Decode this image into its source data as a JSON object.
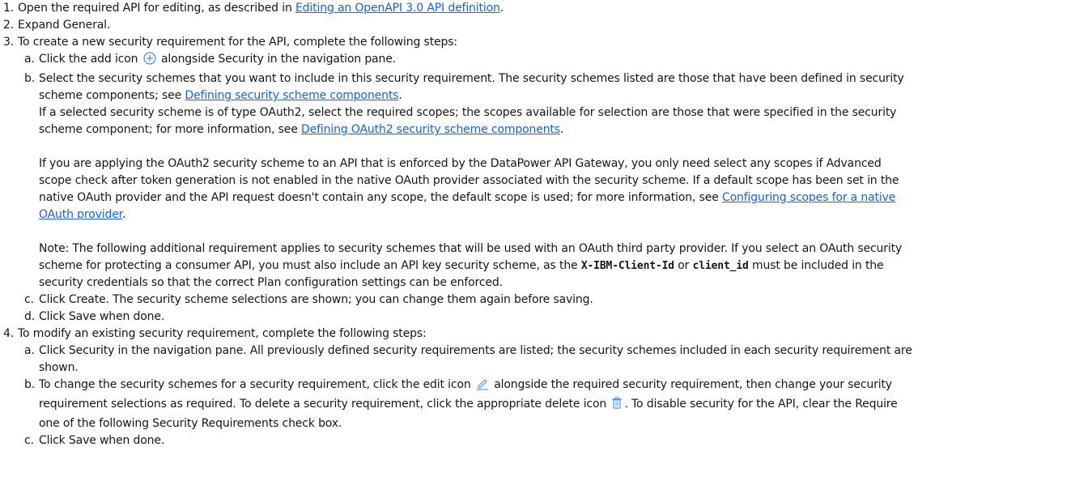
{
  "steps": {
    "s1": {
      "num": "1.",
      "pre": "Open the required API for editing, as described in ",
      "link": "Editing an OpenAPI 3.0 API definition",
      "post": "."
    },
    "s2": {
      "num": "2.",
      "text": "Expand General."
    },
    "s3": {
      "num": "3.",
      "text": "To create a new security requirement for the API, complete the following steps:",
      "a": {
        "num": "a.",
        "pre": "Click the add icon",
        "post": "alongside Security in the navigation pane."
      },
      "b": {
        "num": "b.",
        "l1": "Select the security schemes that you want to include in this security requirement. The security schemes listed are those that have been defined in security",
        "l2_pre": "scheme components; see ",
        "l2_link": "Defining security scheme components",
        "l2_post": ".",
        "p1_l1": "If a selected security scheme is of type OAuth2, select the required scopes; the scopes available for selection are those that were specified in the security",
        "p1_l2_pre": "scheme component; for more information, see ",
        "p1_l2_link": "Defining OAuth2 security scheme components",
        "p1_l2_post": ".",
        "p2_l1": "If you are applying the OAuth2 security scheme to an API that is enforced by the DataPower API Gateway, you only need select any scopes if Advanced",
        "p2_l2": "scope check after token generation is not enabled in the native OAuth provider associated with the security scheme. If a default scope has been set in the",
        "p2_l3_pre": "native OAuth provider and the API request doesn't contain any scope, the default scope is used; for more information, see ",
        "p2_l3_link": "Configuring scopes for a native",
        "p2_l4_link": "OAuth provider",
        "p2_l4_post": ".",
        "p3_l1": "Note: The following additional requirement applies to security schemes that will be used with an OAuth third party provider. If you select an OAuth security",
        "p3_l2_pre": "scheme for protecting a consumer API, you must also include an API key security scheme, as the ",
        "p3_code1": "X-IBM-Client-Id",
        "p3_or": " or ",
        "p3_code2": "client_id",
        "p3_l2_post": " must be included in the",
        "p3_l3": "security credentials so that the correct Plan configuration settings can be enforced."
      },
      "c": {
        "num": "c.",
        "text": "Click Create. The security scheme selections are shown; you can change them again before saving."
      },
      "d": {
        "num": "d.",
        "text": "Click Save when done."
      }
    },
    "s4": {
      "num": "4.",
      "text": "To modify an existing security requirement, complete the following steps:",
      "a": {
        "num": "a.",
        "l1": "Click Security in the navigation pane. All previously defined security requirements are listed; the security schemes included in each security requirement are",
        "l2": "shown."
      },
      "b": {
        "num": "b.",
        "l1_pre": "To change the security schemes for a security requirement, click the edit icon",
        "l1_post": "alongside the required security requirement, then change your security",
        "l2_pre": "requirement selections as required. To delete a security requirement, click the appropriate delete icon",
        "l2_post": ". To disable security for the API, clear the Require",
        "l3": "one of the following Security Requirements check box."
      },
      "c": {
        "num": "c.",
        "text": "Click Save when done."
      }
    }
  },
  "icons": {
    "add": "add-circle-icon",
    "edit": "edit-pencil-icon",
    "delete": "trash-icon",
    "icon_color": "#4589ff"
  }
}
